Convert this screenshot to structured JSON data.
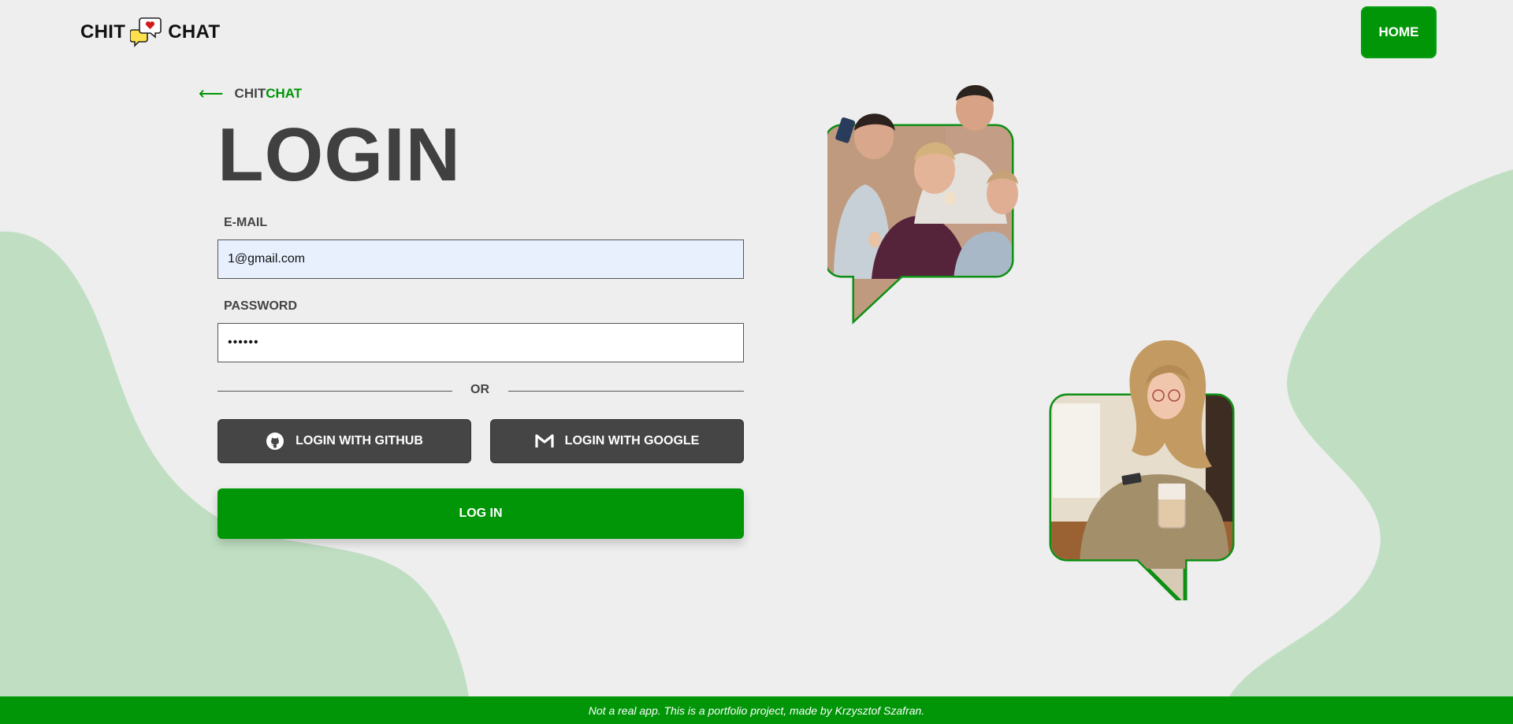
{
  "header": {
    "logo_left": "CHIT",
    "logo_right": "CHAT",
    "home_label": "HOME"
  },
  "back_link": {
    "part1": "CHIT",
    "part2": "CHAT"
  },
  "form": {
    "title": "LOGIN",
    "email_label": "E-MAIL",
    "email_value": "1@gmail.com",
    "password_label": "PASSWORD",
    "password_value": "••••••",
    "divider_text": "OR",
    "github_label": "LOGIN WITH GITHUB",
    "google_label": "LOGIN WITH GOOGLE",
    "submit_label": "LOG IN"
  },
  "footer": {
    "text": "Not a real app. This is a portfolio project, made by Krzysztof Szafran."
  },
  "colors": {
    "brand_green": "#009607",
    "light_green_blob": "#c0dfc2",
    "background": "#eeeeee",
    "dark_button": "#454545",
    "heading": "#404040"
  }
}
